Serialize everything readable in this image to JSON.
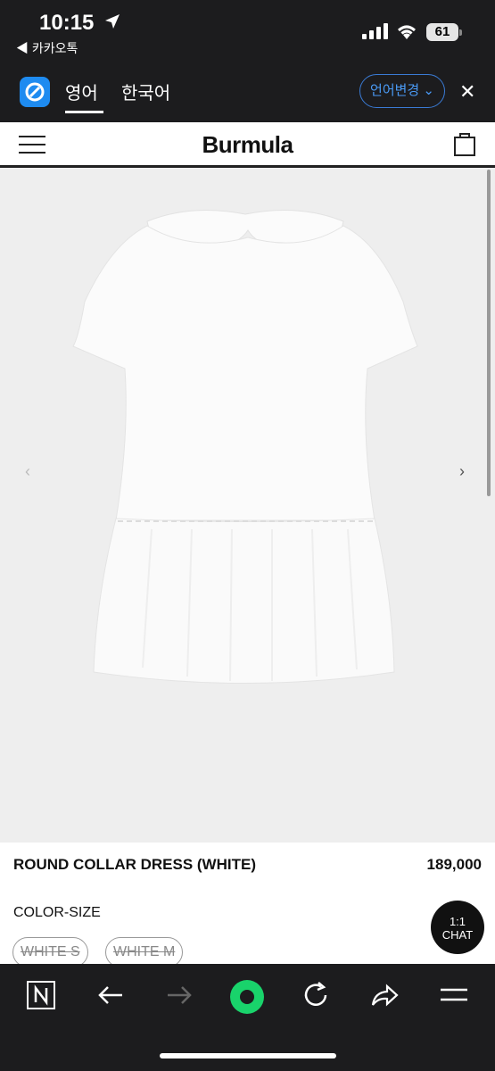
{
  "status": {
    "time": "10:15",
    "back_app": "◀ 카카오톡",
    "battery": "61"
  },
  "translate": {
    "tab_english": "영어",
    "tab_korean": "한국어",
    "change_language": "언어변경"
  },
  "site": {
    "logo": "Burmula"
  },
  "product": {
    "name": "ROUND COLLAR DRESS (WHITE)",
    "price": "189,000",
    "option_label": "COLOR-SIZE",
    "options": [
      "WHITE S",
      "WHITE M"
    ]
  },
  "chat": {
    "line1": "1:1",
    "line2": "CHAT"
  },
  "colors": {
    "accent": "#1e8bf0",
    "refresh": "#19d36b"
  }
}
